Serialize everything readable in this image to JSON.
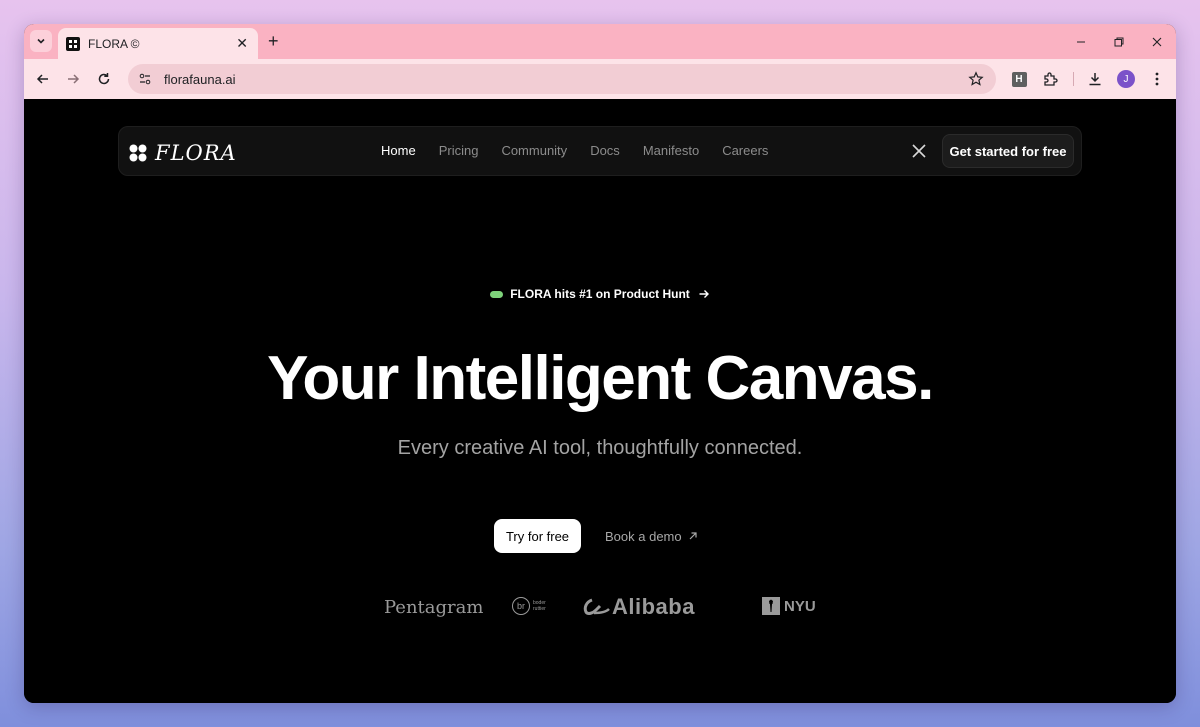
{
  "browser": {
    "tab": {
      "title": "FLORA ©",
      "favicon": "flora-logo-icon"
    },
    "url": "florafauna.ai",
    "profile_initial": "J",
    "extension_label": "H"
  },
  "nav": {
    "logo_text": "FLORA",
    "links": [
      {
        "label": "Home",
        "active": true
      },
      {
        "label": "Pricing",
        "active": false
      },
      {
        "label": "Community",
        "active": false
      },
      {
        "label": "Docs",
        "active": false
      },
      {
        "label": "Manifesto",
        "active": false
      },
      {
        "label": "Careers",
        "active": false
      }
    ],
    "social_icon": "x-logo-icon",
    "cta_label": "Get started for free"
  },
  "announcement": {
    "text": "FLORA hits #1 on Product Hunt",
    "dot_color": "#7ed37a"
  },
  "hero": {
    "title": "Your Intelligent Canvas.",
    "subtitle": "Every creative AI tool, thoughtfully connected."
  },
  "actions": {
    "primary_label": "Try for free",
    "secondary_label": "Book a demo"
  },
  "client_logos": {
    "pentagram": "Pentagram",
    "bodo_mark": "br",
    "bodo_text": "boder ruttier",
    "alibaba": "Alibaba",
    "nyu": "NYU"
  },
  "colors": {
    "tab_strip": "#fab2c2",
    "toolbar": "#fde3e8",
    "page_bg": "#000000",
    "avatar": "#7b52c9"
  }
}
